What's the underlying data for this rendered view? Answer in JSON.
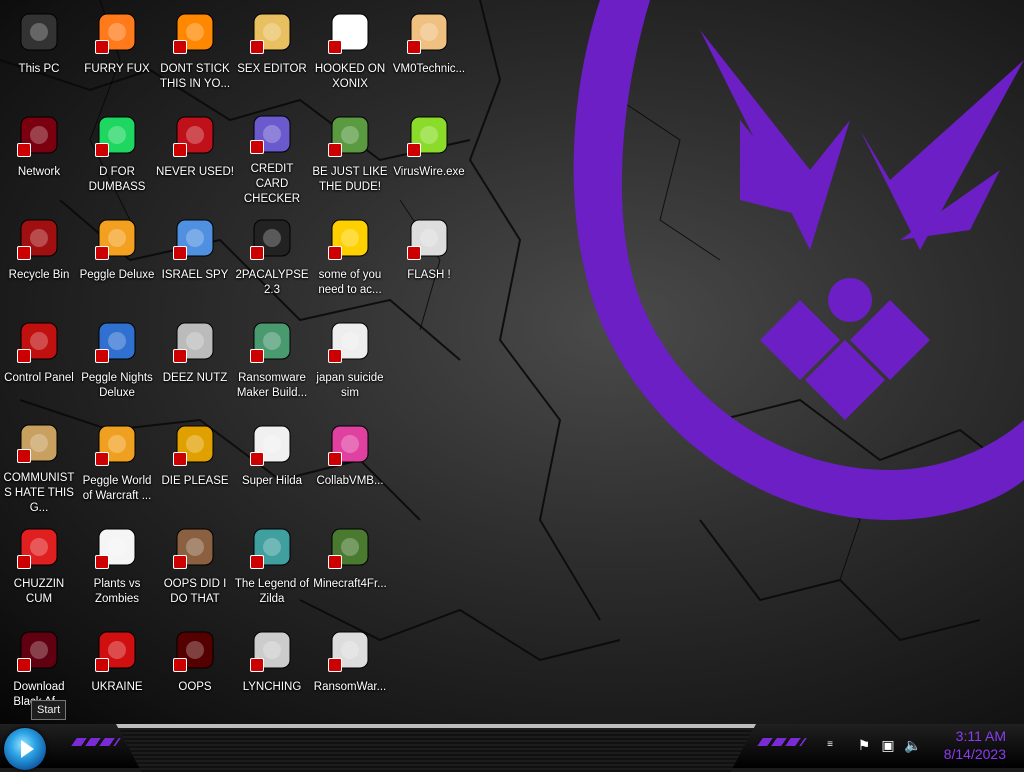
{
  "desktop": {
    "icons": [
      {
        "label": "This PC",
        "icon": "computer-icon"
      },
      {
        "label": "FURRY FUX",
        "icon": "firefox-icon"
      },
      {
        "label": "DONT STICK THIS IN YO...",
        "icon": "vlc-icon"
      },
      {
        "label": "SEX EDITOR",
        "icon": "hex-editor-icon"
      },
      {
        "label": "HOOKED ON XONIX",
        "icon": "xonix-icon"
      },
      {
        "label": "VM0Technic...",
        "icon": "technician-icon"
      },
      {
        "label": "Network",
        "icon": "network-icon"
      },
      {
        "label": "D FOR DUMBASS",
        "icon": "spotify-icon"
      },
      {
        "label": "NEVER USED!",
        "icon": "dev-cpp-icon"
      },
      {
        "label": "CREDIT CARD CHECKER",
        "icon": "credit-card-icon"
      },
      {
        "label": "BE JUST LIKE THE DUDE!",
        "icon": "elf-icon"
      },
      {
        "label": "VirusWire.exe",
        "icon": "lime-icon"
      },
      {
        "label": "Recycle Bin",
        "icon": "recycle-bin-icon"
      },
      {
        "label": "Peggle Deluxe",
        "icon": "peggle-icon"
      },
      {
        "label": "ISRAEL SPY",
        "icon": "spy-icon"
      },
      {
        "label": "2PACALYPSE 2.3",
        "icon": "terminal-icon"
      },
      {
        "label": "some of you need to ac...",
        "icon": "dog-icon"
      },
      {
        "label": "FLASH !",
        "icon": "flash-icon"
      },
      {
        "label": "Control Panel",
        "icon": "control-panel-icon"
      },
      {
        "label": "Peggle Nights Deluxe",
        "icon": "peggle-nights-icon"
      },
      {
        "label": "DEEZ NUTZ",
        "icon": "windows-stack-icon"
      },
      {
        "label": "Ransomware Maker Build...",
        "icon": "ransomware-icon"
      },
      {
        "label": "japan suicide sim",
        "icon": "document-icon"
      },
      {
        "label": "COMMUNISTS HATE THIS G...",
        "icon": "money-bag-icon"
      },
      {
        "label": "Peggle World of Warcraft ...",
        "icon": "peggle-wow-icon"
      },
      {
        "label": "DIE PLEASE",
        "icon": "de-icon"
      },
      {
        "label": "Super Hilda",
        "icon": "pixel-cat-icon"
      },
      {
        "label": "CollabVMB...",
        "icon": "monitor-icon"
      },
      {
        "label": "CHUZZIN CUM",
        "icon": "chuzzle-icon"
      },
      {
        "label": "Plants vs Zombies",
        "icon": "flower-icon"
      },
      {
        "label": "OOPS DID I DO THAT",
        "icon": "portrait-icon"
      },
      {
        "label": "The Legend of Zilda",
        "icon": "pixel-hero-icon"
      },
      {
        "label": "Minecraft4Fr...",
        "icon": "grass-block-icon"
      },
      {
        "label": "Download Black Af...",
        "icon": "dark-orb-icon"
      },
      {
        "label": "UKRAINE",
        "icon": "radiation-icon"
      },
      {
        "label": "OOPS",
        "icon": "red-monitor-icon"
      },
      {
        "label": "LYNCHING",
        "icon": "gear-flag-icon"
      },
      {
        "label": "RansomWar...",
        "icon": "skull-icon"
      }
    ]
  },
  "tooltip": {
    "text": "Start"
  },
  "taskbar": {
    "start_icon": "start-orb-icon",
    "tray": [
      "flag-icon",
      "network-tray-icon",
      "volume-icon"
    ],
    "clock": {
      "time": "3:11 AM",
      "date": "8/14/2023"
    }
  },
  "colors": {
    "accent": "#7a2bd6",
    "clock": "#8a3df0"
  }
}
